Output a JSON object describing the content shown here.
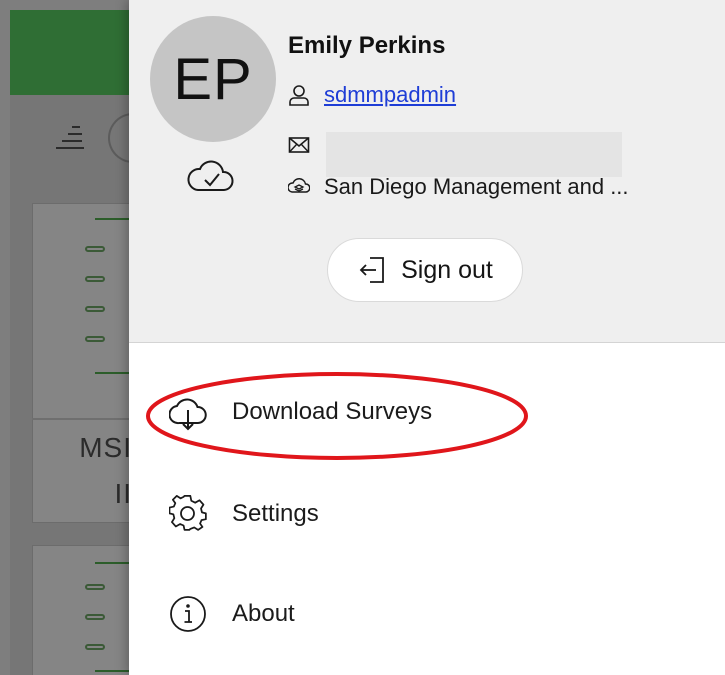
{
  "profile": {
    "initials": "EP",
    "name": "Emily Perkins",
    "username": "sdmmpadmin",
    "email": "",
    "organization": "San Diego Management and ..."
  },
  "signout": {
    "label": "Sign out"
  },
  "menu": {
    "items": [
      {
        "label": "Download Surveys",
        "icon": "cloud-download-icon"
      },
      {
        "label": "Settings",
        "icon": "gear-icon"
      },
      {
        "label": "About",
        "icon": "info-icon"
      }
    ]
  },
  "background": {
    "card_text_line1": "MSI",
    "card_text_line2": "II"
  },
  "colors": {
    "header_green": "#2f6e34",
    "link_blue": "#1e3dd6",
    "highlight_red": "#e0161b",
    "panel_gray": "#efefef"
  }
}
